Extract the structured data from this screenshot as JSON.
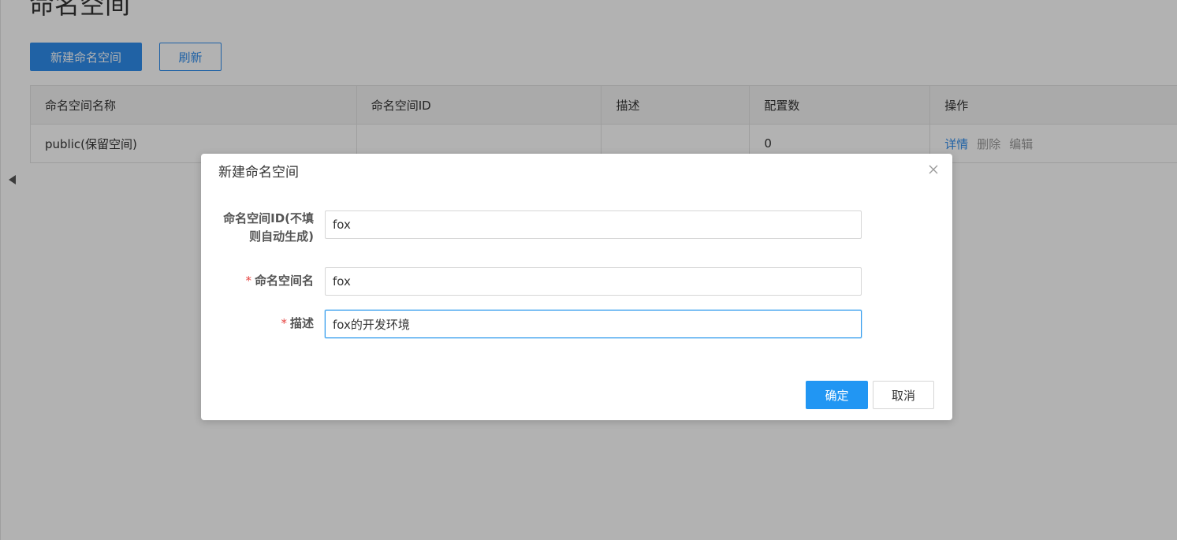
{
  "page": {
    "title": "命名空间",
    "create_button": "新建命名空间",
    "refresh_button": "刷新"
  },
  "table": {
    "headers": [
      "命名空间名称",
      "命名空间ID",
      "描述",
      "配置数",
      "操作"
    ],
    "rows": [
      {
        "name": "public(保留空间)",
        "id": "",
        "description": "",
        "config_count": "0",
        "actions": [
          "详情",
          "删除",
          "编辑"
        ]
      }
    ]
  },
  "dialog": {
    "title": "新建命名空间",
    "close_icon": "close-icon",
    "fields": {
      "id_label": "命名空间ID(不填\n则自动生成)",
      "id_value": "fox",
      "name_label": "命名空间名",
      "name_value": "fox",
      "desc_label": "描述",
      "desc_value": "fox的开发环境",
      "required_mark": "*"
    },
    "confirm_button": "确定",
    "cancel_button": "取消"
  },
  "colors": {
    "primary": "#2f8ded",
    "confirm": "#2196f3",
    "required": "#e64340",
    "overlay": "rgba(0,0,0,0.3)"
  }
}
